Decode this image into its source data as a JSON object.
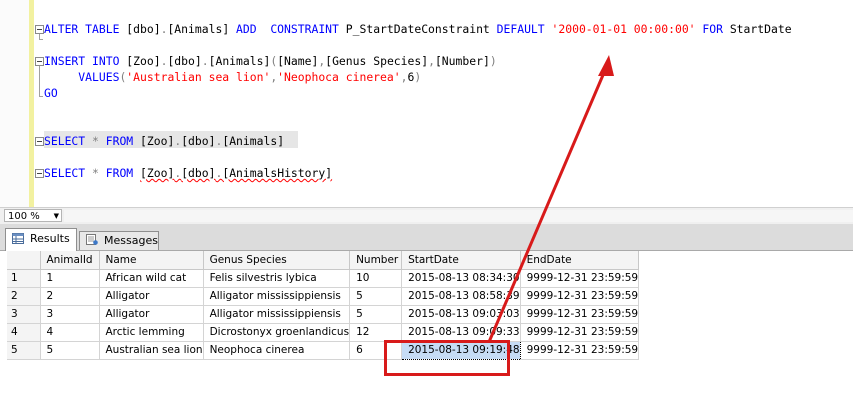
{
  "editor": {
    "lines": [
      {
        "parts": [
          {
            "t": "ALTER TABLE ",
            "c": "kw"
          },
          {
            "t": "[dbo]",
            "c": "obj"
          },
          {
            "t": ".",
            "c": "op"
          },
          {
            "t": "[Animals] ",
            "c": "obj"
          },
          {
            "t": "ADD  CONSTRAINT ",
            "c": "kw"
          },
          {
            "t": "P_StartDateConstraint ",
            "c": "obj"
          },
          {
            "t": "DEFAULT ",
            "c": "kw"
          },
          {
            "t": "'2000-01-01 00:00:00'",
            "c": "str"
          },
          {
            "t": " FOR ",
            "c": "kw"
          },
          {
            "t": "StartDate",
            "c": "obj"
          }
        ]
      },
      {
        "parts": [
          {
            "t": "INSERT INTO ",
            "c": "kw"
          },
          {
            "t": "[Zoo]",
            "c": "obj"
          },
          {
            "t": ".",
            "c": "op"
          },
          {
            "t": "[dbo]",
            "c": "obj"
          },
          {
            "t": ".",
            "c": "op"
          },
          {
            "t": "[Animals]",
            "c": "obj"
          },
          {
            "t": "(",
            "c": "op"
          },
          {
            "t": "[Name]",
            "c": "obj"
          },
          {
            "t": ",",
            "c": "op"
          },
          {
            "t": "[Genus Species]",
            "c": "obj"
          },
          {
            "t": ",",
            "c": "op"
          },
          {
            "t": "[Number]",
            "c": "obj"
          },
          {
            "t": ")",
            "c": "op"
          }
        ]
      },
      {
        "parts": [
          {
            "t": "     VALUES",
            "c": "kw"
          },
          {
            "t": "(",
            "c": "op"
          },
          {
            "t": "'Australian sea lion'",
            "c": "str"
          },
          {
            "t": ",",
            "c": "op"
          },
          {
            "t": "'Neophoca cinerea'",
            "c": "str"
          },
          {
            "t": ",",
            "c": "op"
          },
          {
            "t": "6",
            "c": "obj"
          },
          {
            "t": ")",
            "c": "op"
          }
        ]
      },
      {
        "parts": [
          {
            "t": "GO",
            "c": "kw"
          }
        ]
      },
      {
        "parts": [
          {
            "t": "SELECT ",
            "c": "kw"
          },
          {
            "t": "* ",
            "c": "op"
          },
          {
            "t": "FROM ",
            "c": "kw"
          },
          {
            "t": "[Zoo]",
            "c": "obj"
          },
          {
            "t": ".",
            "c": "op"
          },
          {
            "t": "[dbo]",
            "c": "obj"
          },
          {
            "t": ".",
            "c": "op"
          },
          {
            "t": "[Animals]",
            "c": "obj"
          }
        ]
      },
      {
        "parts": [
          {
            "t": "SELECT ",
            "c": "kw"
          },
          {
            "t": "* ",
            "c": "op"
          },
          {
            "t": "FROM ",
            "c": "kw"
          },
          {
            "t": "[Zoo]",
            "c": "obj squiggle"
          },
          {
            "t": ".",
            "c": "op squiggle"
          },
          {
            "t": "[dbo]",
            "c": "obj squiggle"
          },
          {
            "t": ".",
            "c": "op squiggle"
          },
          {
            "t": "[AnimalsHistory]",
            "c": "obj squiggle"
          }
        ]
      }
    ]
  },
  "zoom": {
    "value": "100 %"
  },
  "tabs": {
    "results": "Results",
    "messages": "Messages"
  },
  "grid": {
    "columns": [
      "",
      "AnimalId",
      "Name",
      "Genus Species",
      "Number",
      "StartDate",
      "EndDate"
    ],
    "rows": [
      [
        "1",
        "1",
        "African wild cat",
        "Felis silvestris lybica",
        "10",
        "2015-08-13 08:34:30",
        "9999-12-31 23:59:59"
      ],
      [
        "2",
        "2",
        "Alligator",
        "Alligator mississippiensis",
        "5",
        "2015-08-13 08:58:39",
        "9999-12-31 23:59:59"
      ],
      [
        "3",
        "3",
        "Alligator",
        "Alligator mississippiensis",
        "5",
        "2015-08-13 09:03:03",
        "9999-12-31 23:59:59"
      ],
      [
        "4",
        "4",
        "Arctic lemming",
        "Dicrostonyx groenlandicus",
        "12",
        "2015-08-13 09:09:33",
        "9999-12-31 23:59:59"
      ],
      [
        "5",
        "5",
        "Australian sea lion",
        "Neophoca cinerea",
        "6",
        "2015-08-13 09:19:48",
        "9999-12-31 23:59:59"
      ]
    ]
  },
  "annotation": {
    "color": "#d81a1a"
  }
}
